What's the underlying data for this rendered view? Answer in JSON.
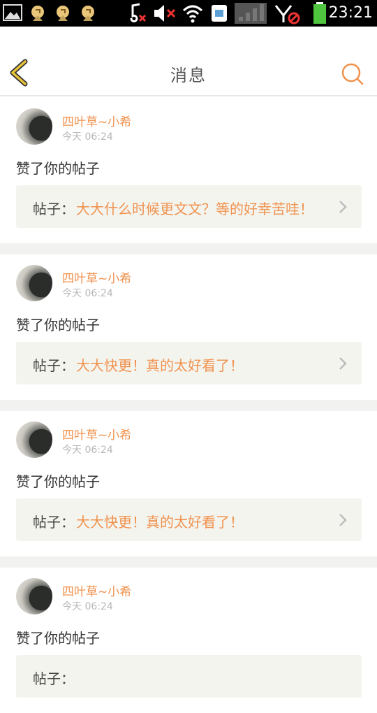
{
  "status_bar": {
    "time": "23:21",
    "icons": [
      "gallery-icon",
      "notification-icon",
      "notification-icon",
      "notification-icon",
      "music-muted-icon",
      "volume-muted-icon",
      "wifi-icon",
      "sim-icon",
      "signal-icon",
      "network-blocked-icon",
      "battery-icon"
    ]
  },
  "header": {
    "title": "消息"
  },
  "messages": [
    {
      "username": "四叶草~小希",
      "time": "今天 06:24",
      "action": "赞了你的帖子",
      "post_label": "帖子：",
      "post_text": "大大什么时候更文文？等的好幸苦哇！"
    },
    {
      "username": "四叶草~小希",
      "time": "今天 06:24",
      "action": "赞了你的帖子",
      "post_label": "帖子：",
      "post_text": "大大快更！真的太好看了！"
    },
    {
      "username": "四叶草~小希",
      "time": "今天 06:24",
      "action": "赞了你的帖子",
      "post_label": "帖子：",
      "post_text": "大大快更！真的太好看了！"
    },
    {
      "username": "四叶草~小希",
      "time": "今天 06:24",
      "action": "赞了你的帖子",
      "post_label": "帖子：",
      "post_text": ""
    }
  ],
  "colors": {
    "accent": "#f0924e",
    "back_arrow": "#e8c33a",
    "post_bg": "#f4f4ef",
    "separator": "#f2f2f0"
  }
}
